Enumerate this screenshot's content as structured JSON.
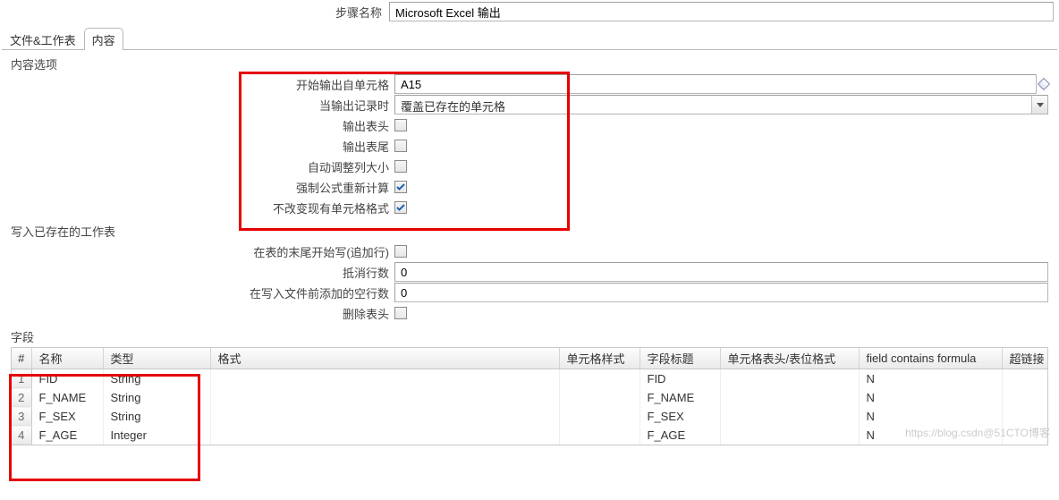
{
  "header": {
    "label": "步骤名称",
    "value": "Microsoft Excel 输出"
  },
  "tabs": [
    {
      "label": "文件&工作表",
      "active": false
    },
    {
      "label": "内容",
      "active": true
    }
  ],
  "content_group": {
    "title": "内容选项",
    "rows": {
      "start_cell": {
        "label": "开始输出自单元格",
        "value": "A15"
      },
      "on_record": {
        "label": "当输出记录时",
        "value": "覆盖已存在的单元格"
      },
      "out_header": {
        "label": "输出表头",
        "checked": false
      },
      "out_footer": {
        "label": "输出表尾",
        "checked": false
      },
      "auto_col": {
        "label": "自动调整列大小",
        "checked": false
      },
      "force_calc": {
        "label": "强制公式重新计算",
        "checked": true
      },
      "keep_fmt": {
        "label": "不改变现有单元格格式",
        "checked": true
      }
    }
  },
  "existing_group": {
    "title": "写入已存在的工作表",
    "rows": {
      "append": {
        "label": "在表的末尾开始写(追加行)",
        "checked": false
      },
      "offset": {
        "label": "抵消行数",
        "value": "0"
      },
      "blank": {
        "label": "在写入文件前添加的空行数",
        "value": "0"
      },
      "del_header": {
        "label": "删除表头",
        "checked": false
      }
    }
  },
  "fields_group": {
    "title": "字段",
    "columns": [
      "#",
      "名称",
      "类型",
      "格式",
      "单元格样式",
      "字段标题",
      "单元格表头/表位格式",
      "field contains formula",
      "超链接"
    ],
    "rows": [
      {
        "n": "1",
        "name": "FID",
        "type": "String",
        "format": "",
        "style": "",
        "title": "FID",
        "hfmt": "",
        "formula": "N",
        "link": ""
      },
      {
        "n": "2",
        "name": "F_NAME",
        "type": "String",
        "format": "",
        "style": "",
        "title": "F_NAME",
        "hfmt": "",
        "formula": "N",
        "link": ""
      },
      {
        "n": "3",
        "name": "F_SEX",
        "type": "String",
        "format": "",
        "style": "",
        "title": "F_SEX",
        "hfmt": "",
        "formula": "N",
        "link": ""
      },
      {
        "n": "4",
        "name": "F_AGE",
        "type": "Integer",
        "format": "",
        "style": "",
        "title": "F_AGE",
        "hfmt": "",
        "formula": "N",
        "link": ""
      }
    ]
  },
  "watermark": "https://blog.csdn@51CTO博客"
}
